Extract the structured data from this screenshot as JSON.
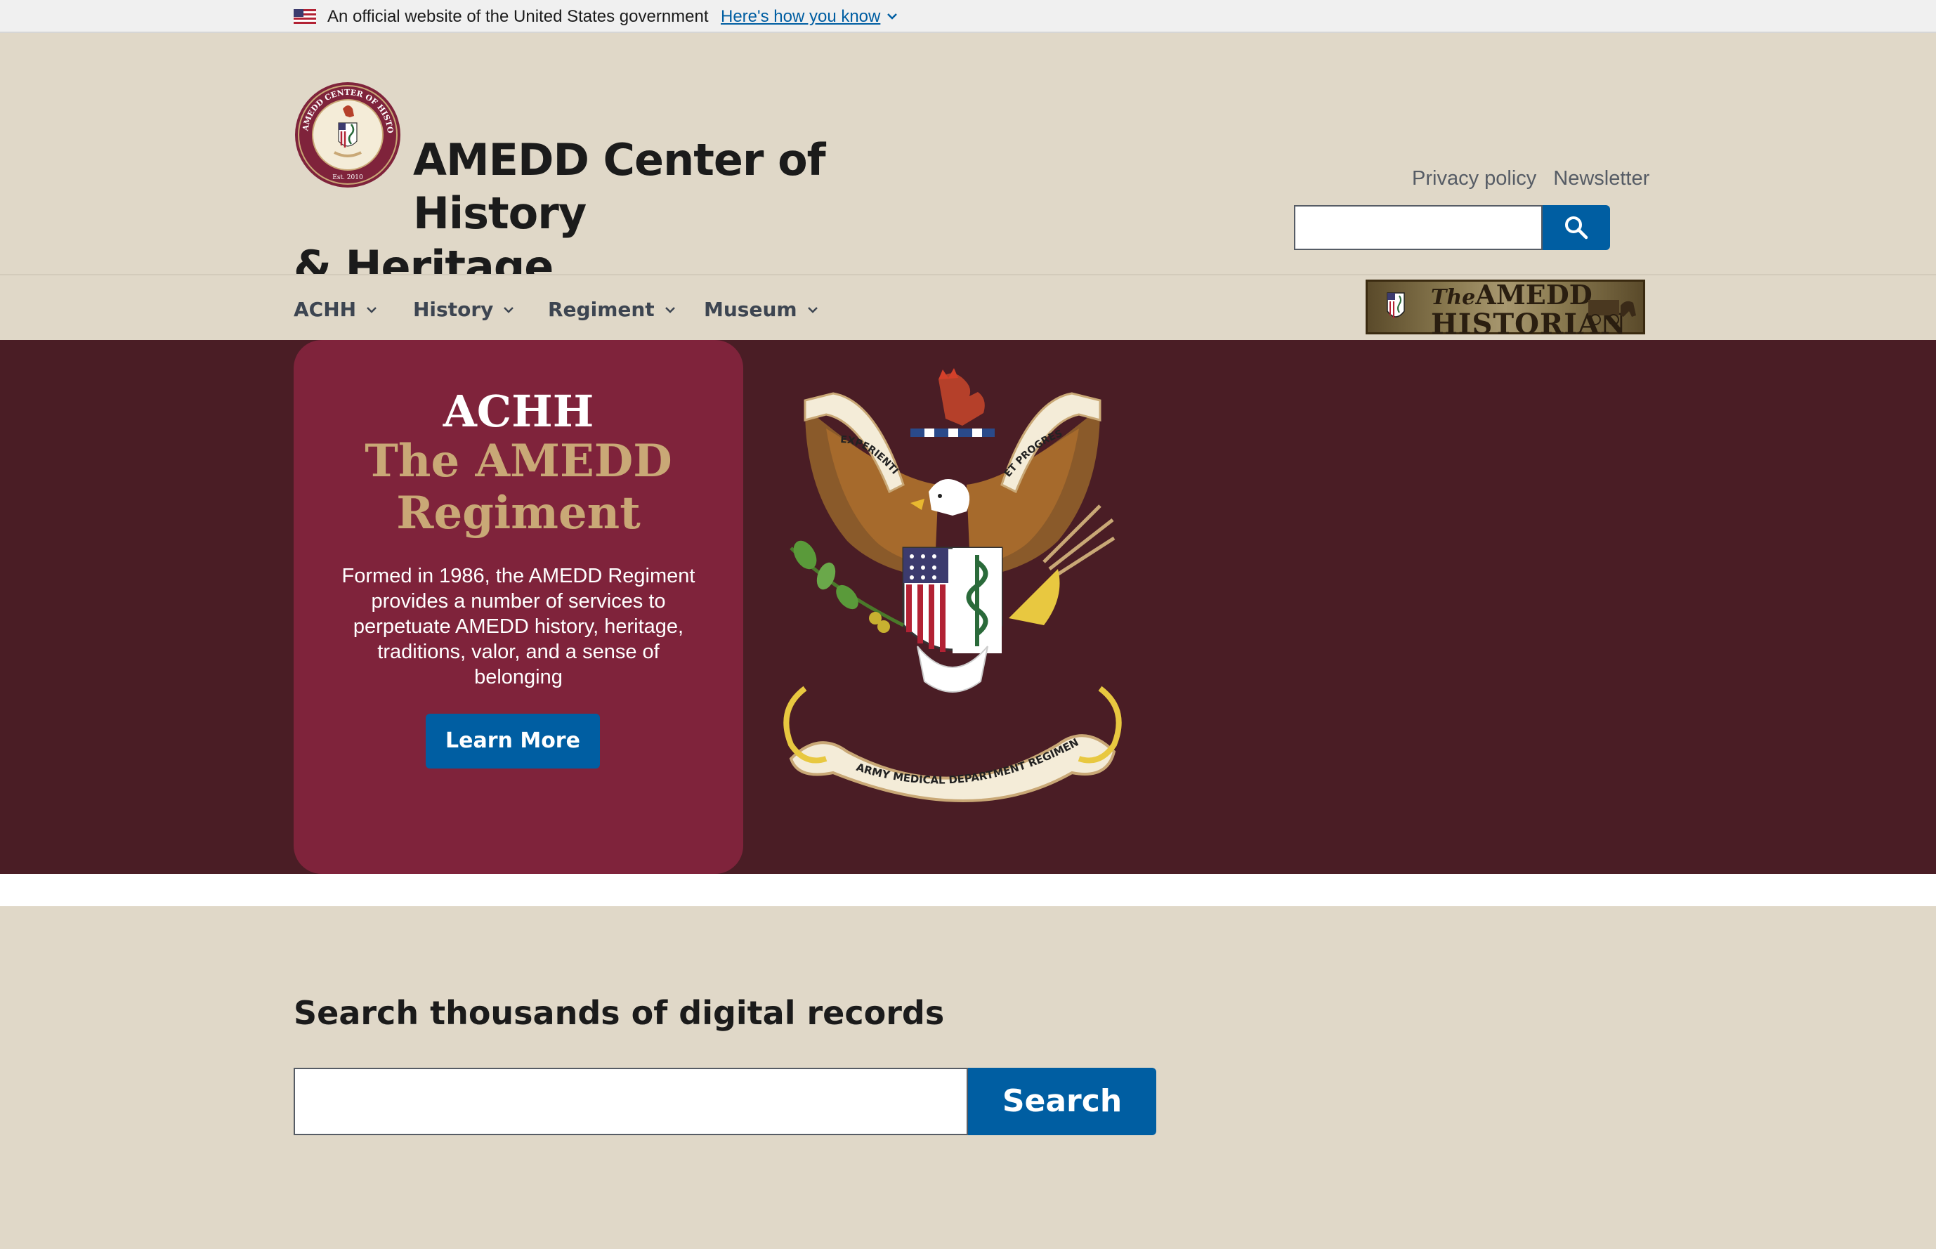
{
  "gov_banner": {
    "text": "An official website of the United States government",
    "link": "Here's how you know"
  },
  "header": {
    "title_line1": "AMEDD Center of History",
    "title_line2": "& Heritage",
    "seal_text": "AMEDD CENTER OF HISTORY AND HERITAGE",
    "seal_est": "Est. 2010",
    "util_links": [
      "Privacy policy",
      "Newsletter"
    ],
    "search_placeholder": ""
  },
  "nav": {
    "items": [
      "ACHH",
      "History",
      "Regiment",
      "Museum"
    ],
    "historian_logo": {
      "the": "The",
      "amedd": "AMEDD",
      "historian": "HISTORIAN"
    }
  },
  "hero": {
    "kicker": "ACHH",
    "title": "The AMEDD Regiment",
    "body": "Formed in 1986, the AMEDD Regiment provides a number of services to perpetuate AMEDD history, heritage, traditions, valor, and a sense of belonging",
    "button": "Learn More",
    "crest_mottos": [
      "EXPERIENTIA",
      "ET PROGRESSUS"
    ],
    "crest_banner": "ARMY MEDICAL DEPARTMENT REGIMENT"
  },
  "records": {
    "title": "Search thousands of digital records",
    "placeholder": "",
    "button": "Search"
  },
  "colors": {
    "primary_blue": "#005ea2",
    "maroon_dark": "#4a1d25",
    "maroon_card": "#7f233b",
    "gold": "#c9a876",
    "tan_bg": "#e0d8c8"
  }
}
